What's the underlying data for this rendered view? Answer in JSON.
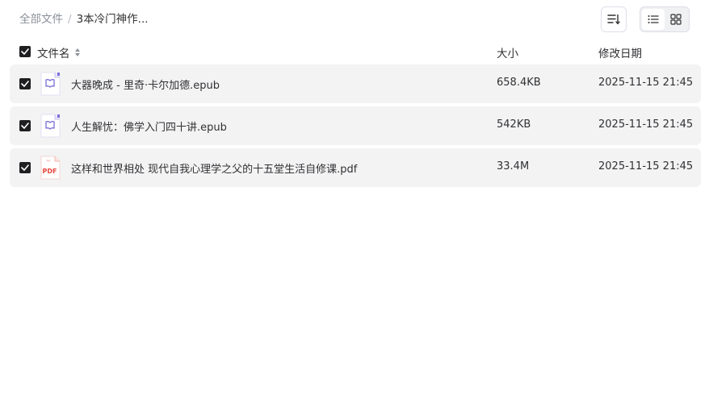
{
  "breadcrumb": {
    "root": "全部文件",
    "separator": "/",
    "current": "3本冷门神作..."
  },
  "toolbar": {
    "sort_icon": "sort-lines-icon",
    "view_list_icon": "list-view-icon",
    "view_grid_icon": "grid-view-icon",
    "active_view": "list"
  },
  "table": {
    "headers": {
      "name": "文件名",
      "size": "大小",
      "modified": "修改日期"
    },
    "all_selected": true,
    "rows": [
      {
        "name": "大器晚成 - 里奇·卡尔加德.epub",
        "size": "658.4KB",
        "modified": "2025-11-15 21:45",
        "type": "epub",
        "selected": true
      },
      {
        "name": "人生解忧：佛学入门四十讲.epub",
        "size": "542KB",
        "modified": "2025-11-15 21:45",
        "type": "epub",
        "selected": true
      },
      {
        "name": "这样和世界相处 现代自我心理学之父的十五堂生活自修课.pdf",
        "size": "33.4M",
        "modified": "2025-11-15 21:45",
        "type": "pdf",
        "selected": true
      }
    ]
  },
  "icons": {
    "pdf_label": "PDF"
  },
  "colors": {
    "checkbox": "#1f1f22",
    "row_bg": "#f3f3f4",
    "epub_accent": "#7b6fd6",
    "pdf_accent": "#e8453c"
  }
}
